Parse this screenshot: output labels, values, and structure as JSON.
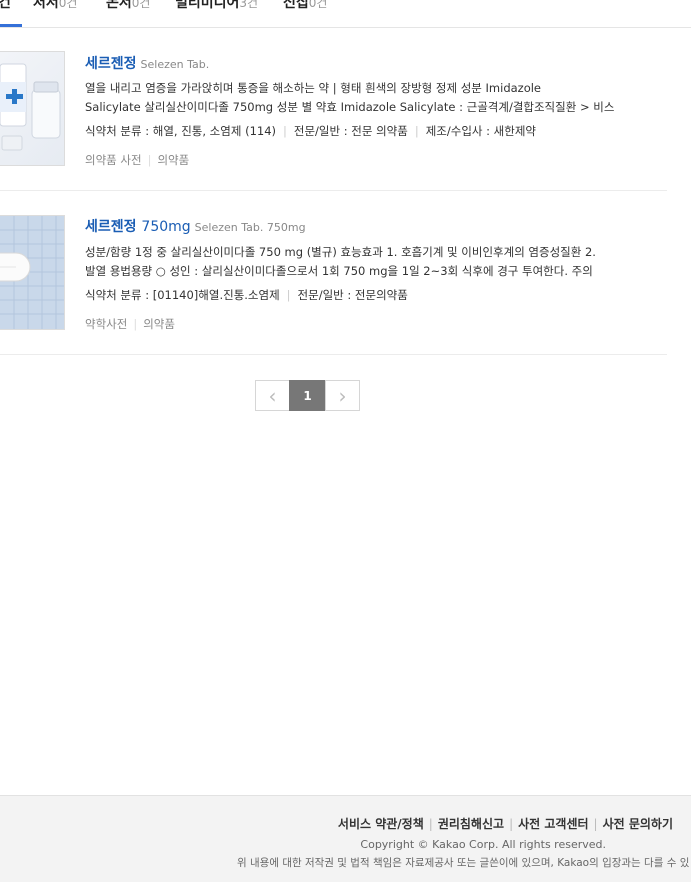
{
  "tabs": [
    {
      "label": "건",
      "count": ""
    },
    {
      "label": "저서",
      "count": "0건"
    },
    {
      "label": "논서",
      "count": "0건"
    },
    {
      "label": "멀티미디어",
      "count": "3건"
    },
    {
      "label": "전집",
      "count": "0건"
    }
  ],
  "results": [
    {
      "title": "세르젠정",
      "title_sub": "Selezen Tab.",
      "desc_line1": "열을 내리고 염증을 가라앉히며 통증을 해소하는 약 | 형태 흰색의 장방형 정제 성분 Imidazole",
      "desc_line2": "Salicylate 살리실산이미다졸 750mg 성분 별 약효 Imidazole Salicylate : 근골격계/결합조직질환 > 비스",
      "meta1": "식약처 분류 : 해열, 진통, 소염제 (114)",
      "meta2": "전문/일반 : 전문 의약품",
      "meta3": "제조/수입사 : 새한제약",
      "tag1": "의약품 사전",
      "tag2": "의약품"
    },
    {
      "title": "세르젠정",
      "title_plain": "750mg",
      "title_sub": "Selezen Tab. 750mg",
      "desc_line1": "성분/함량 1정 중 살리실산이미다졸 750 mg (별규) 효능효과 1. 호흡기계 및 이비인후계의 염증성질환 2.",
      "desc_line2": "발열 용법용량 ○ 성인 : 살리실산이미다졸으로서 1회 750 mg을 1일 2~3회 식후에 경구 투여한다. 주의",
      "meta1": "식약처 분류 : [01140]해열.진통.소염제",
      "meta2": "전문/일반 : 전문의약품",
      "tag1": "약학사전",
      "tag2": "의약품"
    }
  ],
  "pagination": {
    "prev": "‹",
    "current": "1",
    "next": "›"
  },
  "footer": {
    "links": [
      "서비스 약관/정책",
      "권리침해신고",
      "사전 고객센터",
      "사전 문의하기"
    ],
    "copyright": "Copyright © Kakao Corp. All rights reserved.",
    "note": "위 내용에 대한 저작권 및 법적 책임은 자료제공사 또는 글쓴이에 있으며, Kakao의 입장과는 다를 수 있"
  }
}
